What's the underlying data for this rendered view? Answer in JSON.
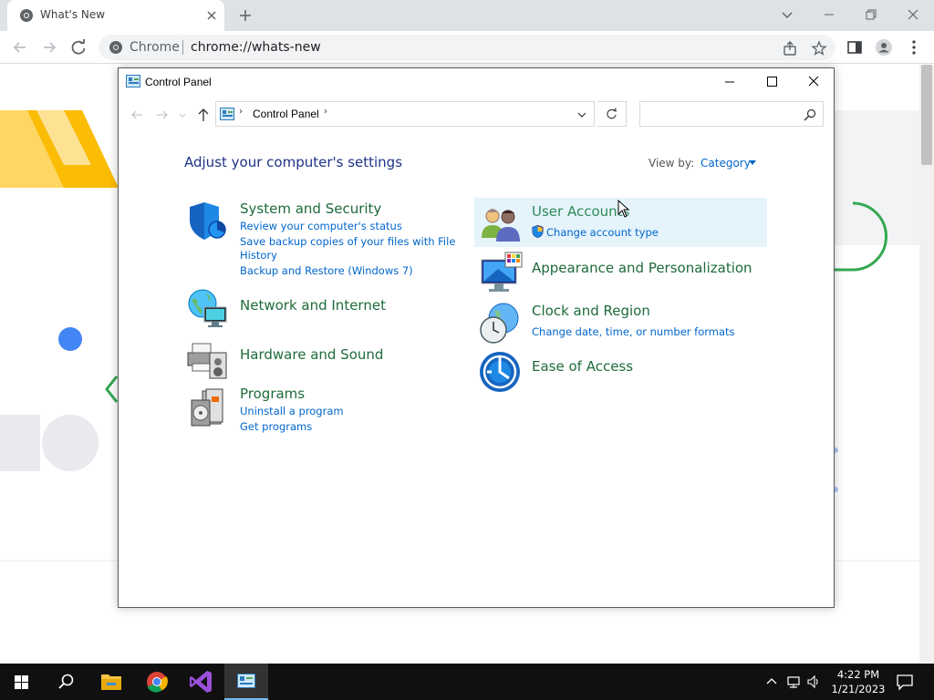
{
  "browser": {
    "tab": {
      "title": "What's New"
    },
    "omnibox": {
      "site_name": "Chrome",
      "url": "chrome://whats-new"
    }
  },
  "control_panel": {
    "window_title": "Control Panel",
    "address": {
      "crumb": "Control Panel"
    },
    "heading": "Adjust your computer's settings",
    "view_by": {
      "label": "View by:",
      "value": "Category"
    },
    "left_categories": [
      {
        "title": "System and Security",
        "icon": "shield-icon",
        "links": [
          "Review your computer's status",
          "Save backup copies of your files with File",
          "History",
          "Backup and Restore (Windows 7)"
        ]
      },
      {
        "title": "Network and Internet",
        "icon": "globe-network-icon",
        "links": []
      },
      {
        "title": "Hardware and Sound",
        "icon": "printer-speaker-icon",
        "links": []
      },
      {
        "title": "Programs",
        "icon": "programs-icon",
        "links": [
          "Uninstall a program",
          "Get programs"
        ]
      }
    ],
    "right_categories": [
      {
        "title": "User Accounts",
        "icon": "users-icon",
        "links": [
          "Change account type"
        ],
        "highlighted": true
      },
      {
        "title": "Appearance and Personalization",
        "icon": "monitor-palette-icon",
        "links": []
      },
      {
        "title": "Clock and Region",
        "icon": "clock-globe-icon",
        "links": [
          "Change date, time, or number formats"
        ]
      },
      {
        "title": "Ease of Access",
        "icon": "ease-of-access-icon",
        "links": []
      }
    ]
  },
  "taskbar": {
    "time": "4:22 PM",
    "date": "1/21/2023",
    "apps": [
      "start-icon",
      "search-icon",
      "file-explorer-icon",
      "chrome-icon",
      "visual-studio-icon",
      "control-panel-icon"
    ]
  },
  "colors": {
    "accent_link": "#0066cc",
    "category_title": "#1e6b3a",
    "heading": "#1e3287",
    "taskbar": "#101010"
  }
}
